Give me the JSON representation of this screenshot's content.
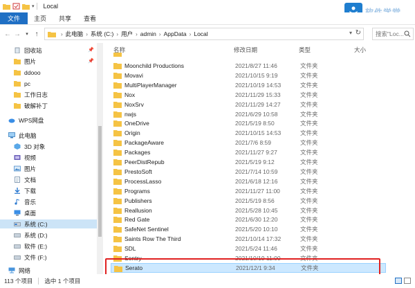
{
  "window": {
    "title": "Local"
  },
  "ribbon": {
    "tabs": [
      "文件",
      "主页",
      "共享",
      "查看"
    ]
  },
  "address": {
    "crumbs": [
      "此电脑",
      "系统 (C:)",
      "用户",
      "admin",
      "AppData",
      "Local"
    ]
  },
  "search": {
    "placeholder": "搜索\"Loc..."
  },
  "watermark": {
    "text": "软件学堂"
  },
  "nav": {
    "quick": [
      {
        "label": "回收站",
        "pinned": true,
        "icon": "recycle-bin-icon"
      },
      {
        "label": "图片",
        "pinned": true,
        "icon": "folder-icon"
      },
      {
        "label": "ddooo",
        "pinned": false,
        "icon": "folder-icon"
      },
      {
        "label": "pc",
        "pinned": false,
        "icon": "folder-icon"
      },
      {
        "label": "工作日志",
        "pinned": false,
        "icon": "folder-icon"
      },
      {
        "label": "破解补丁",
        "pinned": false,
        "icon": "folder-icon"
      }
    ],
    "wps": "WPS网盘",
    "thispc": "此电脑",
    "pc_items": [
      {
        "label": "3D 对象",
        "icon": "3d-objects-icon"
      },
      {
        "label": "视频",
        "icon": "video-icon"
      },
      {
        "label": "图片",
        "icon": "pictures-icon"
      },
      {
        "label": "文档",
        "icon": "documents-icon"
      },
      {
        "label": "下载",
        "icon": "downloads-icon"
      },
      {
        "label": "音乐",
        "icon": "music-icon"
      },
      {
        "label": "桌面",
        "icon": "desktop-icon"
      },
      {
        "label": "系统 (C:)",
        "icon": "drive-icon",
        "selected": true
      },
      {
        "label": "系统 (D:)",
        "icon": "drive-icon"
      },
      {
        "label": "软件 (E:)",
        "icon": "drive-icon"
      },
      {
        "label": "文件 (F:)",
        "icon": "drive-icon"
      }
    ],
    "network": "网络"
  },
  "columns": {
    "name": "名称",
    "date": "修改日期",
    "type": "类型",
    "size": "大小"
  },
  "files": [
    {
      "name": "Moonchild Productions",
      "date": "2021/8/27 11:46",
      "type": "文件夹"
    },
    {
      "name": "Movavi",
      "date": "2021/10/15 9:19",
      "type": "文件夹"
    },
    {
      "name": "MultiPlayerManager",
      "date": "2021/10/19 14:53",
      "type": "文件夹"
    },
    {
      "name": "Nox",
      "date": "2021/11/29 15:33",
      "type": "文件夹"
    },
    {
      "name": "NoxSrv",
      "date": "2021/11/29 14:27",
      "type": "文件夹"
    },
    {
      "name": "nwjs",
      "date": "2021/6/29 10:58",
      "type": "文件夹"
    },
    {
      "name": "OneDrive",
      "date": "2021/5/19 8:50",
      "type": "文件夹"
    },
    {
      "name": "Origin",
      "date": "2021/10/15 14:53",
      "type": "文件夹"
    },
    {
      "name": "PackageAware",
      "date": "2021/7/6 8:59",
      "type": "文件夹"
    },
    {
      "name": "Packages",
      "date": "2021/11/27 9:27",
      "type": "文件夹"
    },
    {
      "name": "PeerDistRepub",
      "date": "2021/5/19 9:12",
      "type": "文件夹"
    },
    {
      "name": "PrestoSoft",
      "date": "2021/7/14 10:59",
      "type": "文件夹"
    },
    {
      "name": "ProcessLasso",
      "date": "2021/6/18 12:16",
      "type": "文件夹"
    },
    {
      "name": "Programs",
      "date": "2021/11/27 11:00",
      "type": "文件夹"
    },
    {
      "name": "Publishers",
      "date": "2021/5/19 8:56",
      "type": "文件夹"
    },
    {
      "name": "Reallusion",
      "date": "2021/5/28 10:45",
      "type": "文件夹"
    },
    {
      "name": "Red Gate",
      "date": "2021/6/30 12:20",
      "type": "文件夹"
    },
    {
      "name": "SafeNet Sentinel",
      "date": "2021/5/20 10:10",
      "type": "文件夹"
    },
    {
      "name": "Saints Row The Third",
      "date": "2021/10/14 17:32",
      "type": "文件夹"
    },
    {
      "name": "SDL",
      "date": "2021/5/24 11:46",
      "type": "文件夹"
    },
    {
      "name": "Sentry",
      "date": "2021/10/19 11:00",
      "type": "文件夹"
    },
    {
      "name": "Serato",
      "date": "2021/12/1 9:34",
      "type": "文件夹",
      "selected": true
    }
  ],
  "status": {
    "count": "113 个项目",
    "selection": "选中 1 个项目"
  },
  "colors": {
    "accent": "#1f6fc4",
    "selection": "#cce8ff",
    "highlight": "#e02020",
    "folder": "#f5c344"
  }
}
